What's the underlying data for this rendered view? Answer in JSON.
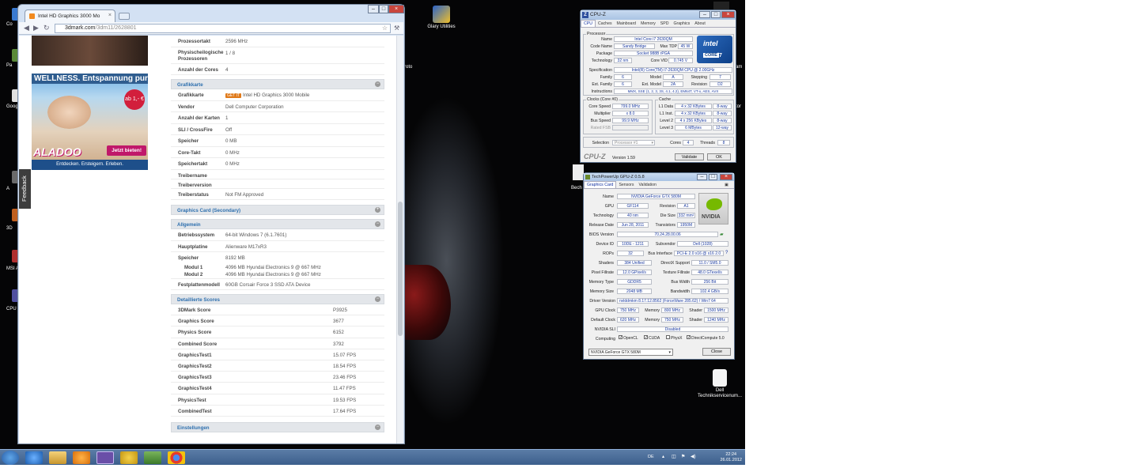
{
  "colors": {
    "desktop_bg": "#050506",
    "accent_link": "#2d6fae",
    "cpuz_value": "#1a3aa0"
  },
  "desktop": {
    "icons": [
      {
        "name": "glary-utilities",
        "label": "Glary Utilities"
      },
      {
        "name": "dell-techniker",
        "label": "Dell Technikservicenum..."
      }
    ],
    "partial_labels": [
      "Co",
      "Pa",
      "Goog",
      "A",
      "3D",
      "MSI A",
      "CPU",
      "Bech",
      "roto",
      "am",
      "tor",
      "n"
    ]
  },
  "browser": {
    "tab_title": "Intel HD Graphics 3000 Mo",
    "url_domain": "3dmark.com",
    "url_path": "/3dm11/2628801",
    "feedback_label": "Feedback",
    "ad": {
      "headline": "WELLNESS. Entspannung pur",
      "badge": "ab 1,- €",
      "logo": "ALADOO",
      "cta": "Jetzt bieten!",
      "footer": "Entdecken. Ersteigern. Erleben."
    },
    "system": [
      {
        "k": "Prozessortakt",
        "v": "2596 MHz"
      },
      {
        "k": "Physischeilogische Prozessoren",
        "v": "1 / 8"
      },
      {
        "k": "Anzahl der Cores",
        "v": "4"
      }
    ],
    "grafik_header": "Grafikkarte",
    "grafik": [
      {
        "k": "Grafikkarte",
        "v": "Intel HD Graphics 3000 Mobile",
        "badge": "GET IT"
      },
      {
        "k": "Vendor",
        "v": "Dell Computer Corporation"
      },
      {
        "k": "Anzahl der Karten",
        "v": "1"
      },
      {
        "k": "SLI / CrossFire",
        "v": "Off"
      },
      {
        "k": "Speicher",
        "v": "0 MB"
      },
      {
        "k": "Core-Takt",
        "v": "0 MHz"
      },
      {
        "k": "Speichertakt",
        "v": "0 MHz"
      },
      {
        "k": "Treibername",
        "v": ""
      },
      {
        "k": "Treiberversion",
        "v": ""
      },
      {
        "k": "Treiberstatus",
        "v": "Not FM Approved"
      }
    ],
    "secondary_header": "Graphics Card (Secondary)",
    "allgemein_header": "Allgemein",
    "allgemein": [
      {
        "k": "Betriebssystem",
        "v": "64-bit Windows 7 (6.1.7601)"
      },
      {
        "k": "Hauptplatine",
        "v": "Alienware M17xR3"
      },
      {
        "k": "Speicher",
        "v": "8192 MB"
      }
    ],
    "module": [
      {
        "k": "Modul 1",
        "v": "4096 MB Hyundai Electronics 9 @ 667 MHz"
      },
      {
        "k": "Modul 2",
        "v": "4096 MB Hyundai Electronics 9 @ 667 MHz"
      }
    ],
    "festplatte": {
      "k": "Festplattenmodell",
      "v": "60GB Corsair Force 3 SSD ATA Device"
    },
    "scores_header": "Detaillierte Scores",
    "scores": [
      {
        "k": "3DMark Score",
        "v": "P3925"
      },
      {
        "k": "Graphics Score",
        "v": "3677"
      },
      {
        "k": "Physics Score",
        "v": "6152"
      },
      {
        "k": "Combined Score",
        "v": "3792"
      },
      {
        "k": "GraphicsTest1",
        "v": "15.07 FPS"
      },
      {
        "k": "GraphicsTest2",
        "v": "18.54 FPS"
      },
      {
        "k": "GraphicsTest3",
        "v": "23.46 FPS"
      },
      {
        "k": "GraphicsTest4",
        "v": "11.47 FPS"
      },
      {
        "k": "PhysicsTest",
        "v": "19.53 FPS"
      },
      {
        "k": "CombinedTest",
        "v": "17.64 FPS"
      }
    ],
    "einstellungen_header": "Einstellungen"
  },
  "cpuz": {
    "title": "CPU-Z",
    "tabs": [
      "CPU",
      "Caches",
      "Mainboard",
      "Memory",
      "SPD",
      "Graphics",
      "About"
    ],
    "processor_group": "Processor",
    "name_label": "Name",
    "name": "Intel Core i7 2630QM",
    "codename_label": "Code Name",
    "codename": "Sandy Bridge",
    "tdp_label": "Max TDP",
    "tdp": "45 W",
    "package_label": "Package",
    "package": "Socket 988B rPGA",
    "tech_label": "Technology",
    "tech": "32 nm",
    "vid_label": "Core VID",
    "vid": "0.745 V",
    "spec_label": "Specification",
    "spec": "Intel(R) Core(TM) i7-2630QM CPU @ 2.00GHz",
    "family_label": "Family",
    "family": "6",
    "model_label": "Model",
    "model": "A",
    "stepping_label": "Stepping",
    "stepping": "7",
    "extfamily_label": "Ext. Family",
    "extfamily": "6",
    "extmodel_label": "Ext. Model",
    "extmodel": "2A",
    "revision_label": "Revision",
    "revision": "D2",
    "instr_label": "Instructions",
    "instr": "MMX, SSE (1, 2, 3, 3S, 4.1, 4.2), EM64T, VT-x, AES, AVX",
    "clocks_group": "Clocks (Core #0)",
    "corespeed_label": "Core Speed",
    "corespeed": "799.0 MHz",
    "multiplier_label": "Multiplier",
    "multiplier": "x 8.0",
    "busspeed_label": "Bus Speed",
    "busspeed": "99.9 MHz",
    "ratedfsb_label": "Rated FSB",
    "cache_group": "Cache",
    "l1d_label": "L1 Data",
    "l1d": "4 x 32 KBytes",
    "l1d_way": "8-way",
    "l1i_label": "L1 Inst.",
    "l1i": "4 x 32 KBytes",
    "l1i_way": "8-way",
    "l2_label": "Level 2",
    "l2": "4 x 256 KBytes",
    "l2_way": "8-way",
    "l3_label": "Level 3",
    "l3": "6 MBytes",
    "l3_way": "12-way",
    "selection_label": "Selection",
    "selection": "Processor #1",
    "cores_label": "Cores",
    "cores": "4",
    "threads_label": "Threads",
    "threads": "8",
    "brand": "CPU-Z",
    "version": "Version 1.59",
    "validate": "Validate",
    "ok": "OK",
    "intel_a": "intel",
    "intel_b": "CORE",
    "intel_c": "i7"
  },
  "gpuz": {
    "title": "TechPowerUp GPU-Z 0.5.8",
    "tabs": [
      "Graphics Card",
      "Sensors",
      "Validation"
    ],
    "rows": [
      {
        "l": "Name",
        "v": "NVIDIA GeForce GTX 580M"
      },
      {
        "l": "GPU",
        "v": "GF114",
        "l2": "Revision",
        "v2": "A1"
      },
      {
        "l": "Technology",
        "v": "40 nm",
        "l2": "Die Size",
        "v2": "332 mm²"
      },
      {
        "l": "Release Date",
        "v": "Jun 28, 2011",
        "l2": "Transistors",
        "v2": "1950M"
      },
      {
        "l": "BIOS Version",
        "v": "70.24.28.00.06"
      },
      {
        "l": "Device ID",
        "v": "10DE - 1211",
        "l2": "Subvendor",
        "v2": "Dell (1028)"
      },
      {
        "l": "ROPs",
        "v": "32",
        "l2": "Bus Interface",
        "v2": "PCI-E 2.0 x16 @ x16 2.0"
      },
      {
        "l": "Shaders",
        "v": "384 Unified",
        "l2": "DirectX Support",
        "v2": "11.0 / SM5.0"
      },
      {
        "l": "Pixel Fillrate",
        "v": "12.0 GPixel/s",
        "l2": "Texture Fillrate",
        "v2": "48.0 GTexel/s"
      },
      {
        "l": "Memory Type",
        "v": "GDDR5",
        "l2": "Bus Width",
        "v2": "256 Bit"
      },
      {
        "l": "Memory Size",
        "v": "2048 MB",
        "l2": "Bandwidth",
        "v2": "102.4 GB/s"
      },
      {
        "l": "Driver Version",
        "v": "nvlddmkm 8.17.12.8562 (ForceWare 285.62) / Win7 64"
      }
    ],
    "gpu_clock_label": "GPU Clock",
    "gpu_clock": "750 MHz",
    "default_clock_label": "Default Clock",
    "default_clock": "620 MHz",
    "memory_label": "Memory",
    "mem1": "800 MHz",
    "mem2": "750 MHz",
    "shader_label": "Shader",
    "sh1": "1500 MHz",
    "sh2": "1240 MHz",
    "sli_label": "NVIDIA SLI",
    "sli": "Disabled",
    "computing_label": "Computing",
    "compute": [
      {
        "label": "OpenCL",
        "checked": true
      },
      {
        "label": "CUDA",
        "checked": true
      },
      {
        "label": "PhysX",
        "checked": false
      },
      {
        "label": "DirectCompute 5.0",
        "checked": true
      }
    ],
    "select": "NVIDIA GeForce GTX 580M",
    "close": "Close",
    "nvidia": "NVIDIA"
  },
  "taskbar": {
    "lang": "DE",
    "time": "22:24",
    "date": "26.01.2012"
  }
}
